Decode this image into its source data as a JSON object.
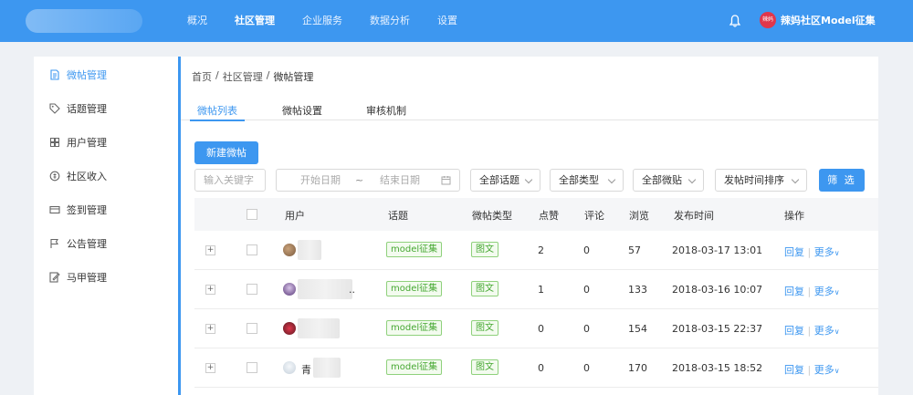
{
  "header": {
    "nav": [
      "概况",
      "社区管理",
      "企业服务",
      "数据分析",
      "设置"
    ],
    "active_nav": 1,
    "avatar_text": "辣妈",
    "user_name": "辣妈社区Model征集",
    "accent": "#3d97f0"
  },
  "sidebar": {
    "items": [
      {
        "label": "微帖管理",
        "icon": "document-icon",
        "active": true
      },
      {
        "label": "话题管理",
        "icon": "tag-icon",
        "active": false
      },
      {
        "label": "用户管理",
        "icon": "user-icon",
        "active": false
      },
      {
        "label": "社区收入",
        "icon": "coin-icon",
        "active": false
      },
      {
        "label": "签到管理",
        "icon": "card-icon",
        "active": false
      },
      {
        "label": "公告管理",
        "icon": "flag-icon",
        "active": false
      },
      {
        "label": "马甲管理",
        "icon": "edit-icon",
        "active": false
      }
    ]
  },
  "breadcrumb": [
    "首页",
    "/",
    "社区管理",
    "/",
    "微帖管理"
  ],
  "tabs": [
    "微帖列表",
    "微帖设置",
    "审核机制"
  ],
  "new_button": "新建微帖",
  "filters": {
    "keyword_placeholder": "输入关键字",
    "start_date_placeholder": "开始日期",
    "date_sep": "~",
    "end_date_placeholder": "结束日期",
    "topic": "全部话题",
    "type": "全部类型",
    "post": "全部微贴",
    "sort": "发帖时间排序",
    "submit": "筛 选"
  },
  "table": {
    "headers": [
      "用户",
      "话题",
      "微帖类型",
      "点赞",
      "评论",
      "浏览",
      "发布时间",
      "操作"
    ],
    "rows": [
      {
        "user": "",
        "topic": "model征集",
        "type": "图文",
        "likes": "2",
        "comments": "0",
        "views": "57",
        "time": "2018-03-17 13:01",
        "reply": "回复",
        "more": "更多"
      },
      {
        "user": "..",
        "topic": "model征集",
        "type": "图文",
        "likes": "1",
        "comments": "0",
        "views": "133",
        "time": "2018-03-16 10:07",
        "reply": "回复",
        "more": "更多"
      },
      {
        "user": "",
        "topic": "model征集",
        "type": "图文",
        "likes": "0",
        "comments": "0",
        "views": "154",
        "time": "2018-03-15 22:37",
        "reply": "回复",
        "more": "更多"
      },
      {
        "user": "青",
        "topic": "model征集",
        "type": "图文",
        "likes": "0",
        "comments": "0",
        "views": "170",
        "time": "2018-03-15 18:52",
        "reply": "回复",
        "more": "更多"
      }
    ]
  }
}
